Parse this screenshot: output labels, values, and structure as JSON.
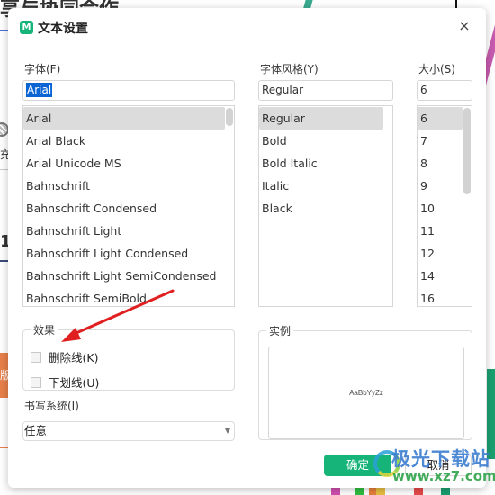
{
  "background_app": {
    "title_fragment": "享与协同合作",
    "side_char": "充",
    "side_number": "1",
    "orange_button_char": "版"
  },
  "dialog": {
    "title": "文本设置",
    "logo_glyph": "M",
    "close_glyph": "×",
    "font": {
      "label": "字体(F)",
      "value": "Arial",
      "items": [
        "Arial",
        "Arial Black",
        "Arial Unicode MS",
        "Bahnschrift",
        "Bahnschrift Condensed",
        "Bahnschrift Light",
        "Bahnschrift Light Condensed",
        "Bahnschrift Light SemiCondensed",
        "Bahnschrift SemiBold"
      ],
      "selected": "Arial"
    },
    "style": {
      "label": "字体风格(Y)",
      "value": "Regular",
      "items": [
        "Regular",
        "Bold",
        "Bold Italic",
        "Italic",
        "Black"
      ],
      "selected": "Regular"
    },
    "size": {
      "label": "大小(S)",
      "value": "6",
      "items": [
        "6",
        "7",
        "8",
        "9",
        "10",
        "11",
        "12",
        "14",
        "16"
      ],
      "selected": "6"
    },
    "effects": {
      "legend": "效果",
      "strikethrough": {
        "label": "删除线(K)",
        "checked": false
      },
      "underline": {
        "label": "下划线(U)",
        "checked": false
      }
    },
    "preview": {
      "legend": "实例",
      "sample_text": "AaBbYyZz"
    },
    "writing_system": {
      "label": "书写系统(I)",
      "value": "任意",
      "arrow_glyph": "▼"
    },
    "buttons": {
      "ok": "确定",
      "cancel": "取消"
    }
  },
  "watermark": {
    "name": "极光下载站",
    "url": "www.xz7.com"
  },
  "colors": {
    "accent": "#17b47a",
    "selection": "#0a64d4",
    "annotation_arrow": "#e02020"
  }
}
